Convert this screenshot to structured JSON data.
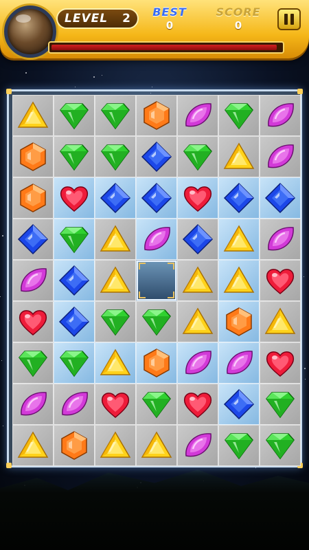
{
  "hud": {
    "level_label": "LEVEL",
    "level_value": "2",
    "best_label": "BEST",
    "best_value": "0",
    "score_label": "SCORE",
    "score_value": "0",
    "progress": 0.97
  },
  "colors": {
    "green": "#2fd12f",
    "yellow": "#ffd21a",
    "orange": "#ff7a18",
    "purple": "#d23ad8",
    "blue": "#1c47e8",
    "red": "#ee1c3a"
  },
  "board": {
    "rows": [
      [
        [
          "yellow-triangle-gem",
          "g"
        ],
        [
          "green-diamond-gem",
          "g"
        ],
        [
          "green-diamond-gem",
          "g"
        ],
        [
          "orange-hexagon-gem",
          "g"
        ],
        [
          "purple-leaf-gem",
          "g"
        ],
        [
          "green-diamond-gem",
          "g"
        ],
        [
          "purple-leaf-gem",
          "g"
        ]
      ],
      [
        [
          "orange-hexagon-gem",
          "g"
        ],
        [
          "green-diamond-gem",
          "g"
        ],
        [
          "green-diamond-gem",
          "g"
        ],
        [
          "blue-square-gem",
          "g"
        ],
        [
          "green-diamond-gem",
          "g"
        ],
        [
          "yellow-triangle-gem",
          "g"
        ],
        [
          "purple-leaf-gem",
          "g"
        ]
      ],
      [
        [
          "orange-hexagon-gem",
          "g"
        ],
        [
          "red-heart-gem",
          "b"
        ],
        [
          "blue-square-gem",
          "b"
        ],
        [
          "blue-square-gem",
          "b"
        ],
        [
          "red-heart-gem",
          "b"
        ],
        [
          "blue-square-gem",
          "b"
        ],
        [
          "blue-square-gem",
          "b"
        ]
      ],
      [
        [
          "blue-square-gem",
          "g"
        ],
        [
          "green-diamond-gem",
          "b"
        ],
        [
          "yellow-triangle-gem",
          "g"
        ],
        [
          "purple-leaf-gem",
          "b"
        ],
        [
          "blue-square-gem",
          "g"
        ],
        [
          "yellow-triangle-gem",
          "b"
        ],
        [
          "purple-leaf-gem",
          "g"
        ]
      ],
      [
        [
          "purple-leaf-gem",
          "g"
        ],
        [
          "blue-square-gem",
          "b"
        ],
        [
          "yellow-triangle-gem",
          "g"
        ],
        [
          "empty",
          "hole"
        ],
        [
          "yellow-triangle-gem",
          "g"
        ],
        [
          "yellow-triangle-gem",
          "b"
        ],
        [
          "red-heart-gem",
          "g"
        ]
      ],
      [
        [
          "red-heart-gem",
          "g"
        ],
        [
          "blue-square-gem",
          "b"
        ],
        [
          "green-diamond-gem",
          "g"
        ],
        [
          "green-diamond-gem",
          "g"
        ],
        [
          "yellow-triangle-gem",
          "g"
        ],
        [
          "orange-hexagon-gem",
          "b"
        ],
        [
          "yellow-triangle-gem",
          "g"
        ]
      ],
      [
        [
          "green-diamond-gem",
          "g"
        ],
        [
          "green-diamond-gem",
          "b"
        ],
        [
          "yellow-triangle-gem",
          "b"
        ],
        [
          "orange-hexagon-gem",
          "b"
        ],
        [
          "purple-leaf-gem",
          "b"
        ],
        [
          "purple-leaf-gem",
          "b"
        ],
        [
          "red-heart-gem",
          "g"
        ]
      ],
      [
        [
          "purple-leaf-gem",
          "g"
        ],
        [
          "purple-leaf-gem",
          "g"
        ],
        [
          "red-heart-gem",
          "g"
        ],
        [
          "green-diamond-gem",
          "g"
        ],
        [
          "red-heart-gem",
          "g"
        ],
        [
          "blue-square-gem",
          "b"
        ],
        [
          "green-diamond-gem",
          "g"
        ]
      ],
      [
        [
          "yellow-triangle-gem",
          "g"
        ],
        [
          "orange-hexagon-gem",
          "g"
        ],
        [
          "yellow-triangle-gem",
          "g"
        ],
        [
          "yellow-triangle-gem",
          "g"
        ],
        [
          "purple-leaf-gem",
          "g"
        ],
        [
          "green-diamond-gem",
          "g"
        ],
        [
          "green-diamond-gem",
          "g"
        ]
      ]
    ]
  }
}
